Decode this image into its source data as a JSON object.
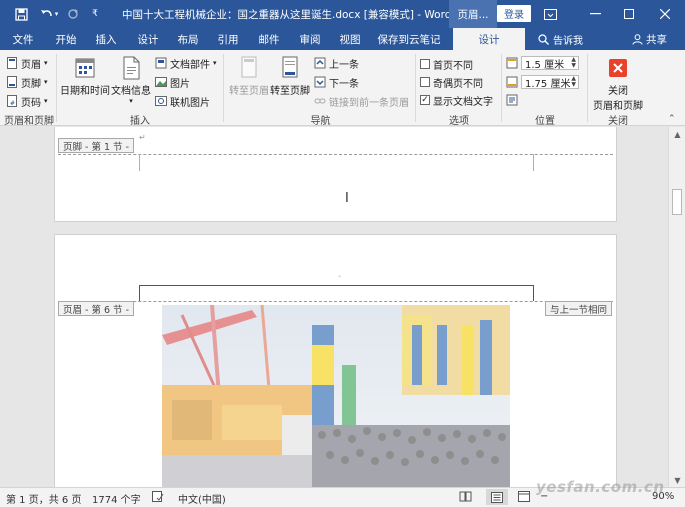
{
  "titlebar": {
    "title": "中国十大工程机械企业：国之重器从这里诞生.docx [兼容模式] - Word",
    "context_tab": "页眉...",
    "login": "登录",
    "save_icon": "save-icon",
    "undo_icon": "undo-icon",
    "redo_icon": "redo-icon"
  },
  "tabs": [
    "文件",
    "开始",
    "插入",
    "设计",
    "布局",
    "引用",
    "邮件",
    "审阅",
    "视图",
    "保存到云笔记",
    "设计"
  ],
  "tell_me": "告诉我",
  "share": "共享",
  "ribbon": {
    "header_footer": {
      "header": "页眉",
      "footer": "页脚",
      "page_number": "页码",
      "label": "页眉和页脚"
    },
    "insert": {
      "date_time": "日期和时间",
      "doc_info": "文档信息",
      "quick_parts": "文档部件",
      "picture": "图片",
      "online_picture": "联机图片",
      "label": "插入"
    },
    "navigation": {
      "goto_header": "转至页眉",
      "goto_footer": "转至页脚",
      "previous": "上一条",
      "next": "下一条",
      "link_previous": "链接到前一条页眉",
      "label": "导航"
    },
    "options": {
      "different_first": "首页不同",
      "different_odd_even": "奇偶页不同",
      "show_doc_text": "显示文档文字",
      "different_first_checked": false,
      "different_odd_even_checked": false,
      "show_doc_text_checked": true,
      "label": "选项"
    },
    "position": {
      "header_from_top": "1.5 厘米",
      "footer_from_bottom": "1.75 厘米",
      "label": "位置"
    },
    "close": {
      "button": "关闭\n页眉和页脚",
      "line1": "关闭",
      "line2": "页眉和页脚",
      "label": "关闭"
    }
  },
  "document": {
    "footer_tag": "页脚 - 第 1 节 -",
    "header_tag": "页眉 - 第 6 节 -",
    "same_as_previous": "与上一节相同"
  },
  "status": {
    "page": "第 1 页，共 6 页",
    "words": "1774 个字",
    "language": "中文(中国)",
    "zoom": "90%"
  },
  "watermark": "yesfan.com.cn",
  "colors": {
    "accent": "#2b579a",
    "close_red": "#e8412c"
  }
}
